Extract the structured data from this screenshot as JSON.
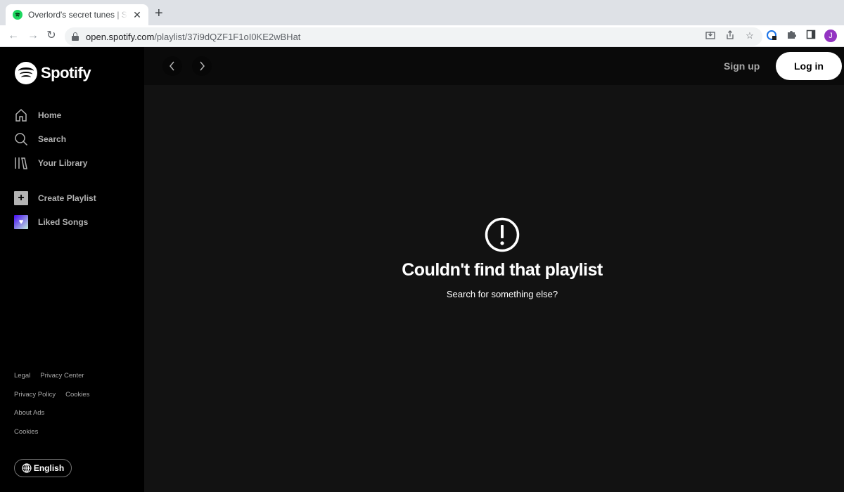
{
  "browser": {
    "tab_title": "Overlord's secret tunes | Spotify",
    "url_host": "open.spotify.com",
    "url_path": "/playlist/37i9dQZF1F1oI0KE2wBHat",
    "avatar_letter": "J"
  },
  "sidebar": {
    "logo_text": "Spotify",
    "nav": [
      {
        "label": "Home",
        "icon": "home-icon"
      },
      {
        "label": "Search",
        "icon": "search-icon"
      },
      {
        "label": "Your Library",
        "icon": "library-icon"
      }
    ],
    "actions": [
      {
        "label": "Create Playlist",
        "icon": "plus-icon"
      },
      {
        "label": "Liked Songs",
        "icon": "heart-icon"
      }
    ],
    "footer_links": [
      [
        "Legal",
        "Privacy Center"
      ],
      [
        "Privacy Policy",
        "Cookies"
      ],
      [
        "About Ads"
      ],
      [
        "Cookies"
      ]
    ],
    "language_label": "English"
  },
  "topbar": {
    "signup_label": "Sign up",
    "login_label": "Log in"
  },
  "error": {
    "title": "Couldn't find that playlist",
    "subtitle": "Search for something else?"
  }
}
